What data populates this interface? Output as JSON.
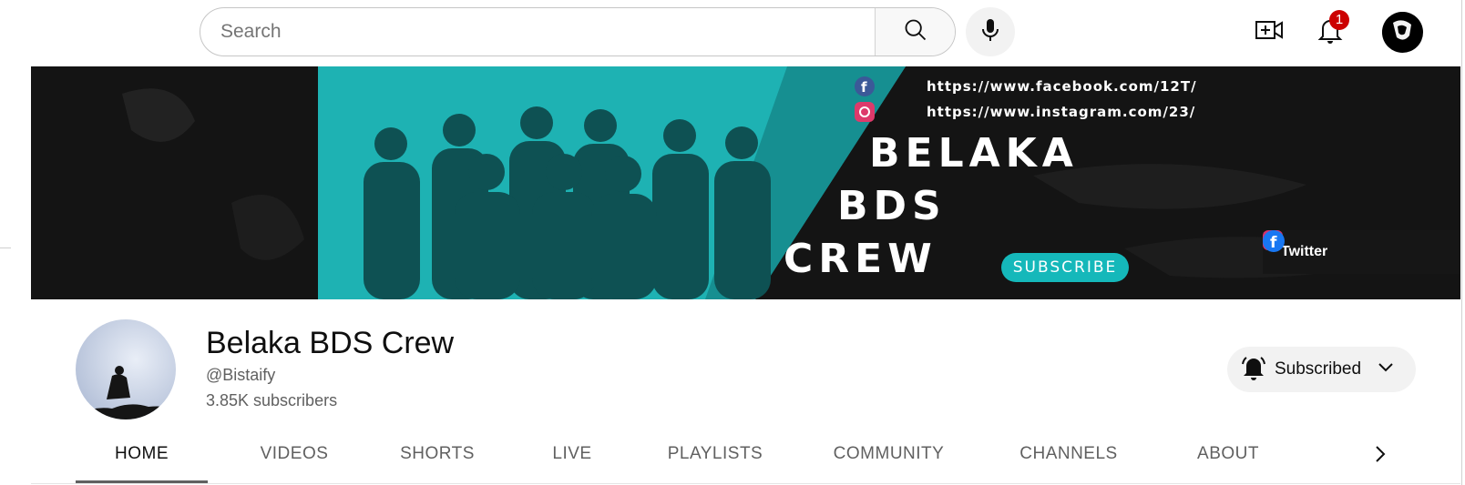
{
  "search": {
    "placeholder": "Search"
  },
  "header": {
    "icons": [
      "search-icon",
      "mic-icon",
      "create-video-icon",
      "notifications-icon",
      "account-avatar"
    ],
    "notification_count": "1"
  },
  "banner": {
    "facebook_link": "https://www.facebook.com/12T/",
    "instagram_link": "https://www.instagram.com/23/",
    "title_line1": "BELAKA",
    "title_line2": "BDS",
    "title_line3": "CREW",
    "subscribe_label": "SUBSCRIBE",
    "twitter_label": "Twitter",
    "accent_color": "#1fb4b6"
  },
  "channel": {
    "name": "Belaka BDS Crew",
    "handle": "@Bistaify",
    "subscribers": "3.85K subscribers",
    "subscribed_label": "Subscribed"
  },
  "tabs": [
    {
      "label": "HOME",
      "active": true
    },
    {
      "label": "VIDEOS"
    },
    {
      "label": "SHORTS"
    },
    {
      "label": "LIVE"
    },
    {
      "label": "PLAYLISTS"
    },
    {
      "label": "COMMUNITY"
    },
    {
      "label": "CHANNELS"
    },
    {
      "label": "ABOUT"
    }
  ]
}
